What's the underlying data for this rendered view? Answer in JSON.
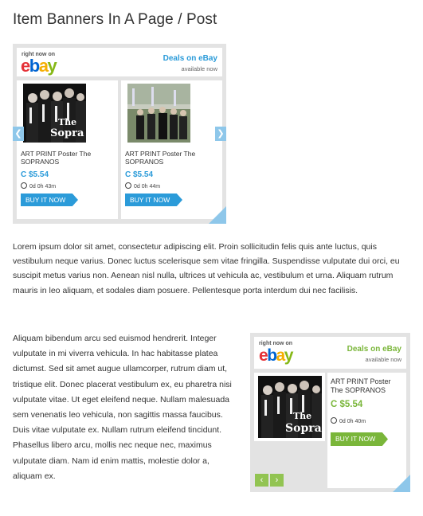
{
  "page": {
    "title": "Item Banners In A Page / Post"
  },
  "banner_wide": {
    "right_now_on": "right now on",
    "logo": [
      "e",
      "b",
      "a",
      "y"
    ],
    "deals_title": "Deals on eBay",
    "available": "available now",
    "accent_color": "#2b9bd9",
    "prev_icon": "chevron-left-icon",
    "next_icon": "chevron-right-icon",
    "prev_glyph": "❮",
    "next_glyph": "❯",
    "items": [
      {
        "title": "ART PRINT Poster The SOPRANOS",
        "price": "C $5.54",
        "time": "0d 0h 43m",
        "buy": "BUY IT NOW"
      },
      {
        "title": "ART PRINT Poster The SOPRANOS",
        "price": "C $5.54",
        "time": "0d 0h 44m",
        "buy": "BUY IT NOW"
      }
    ]
  },
  "paragraph1": "Lorem ipsum dolor sit amet, consectetur adipiscing elit. Proin sollicitudin felis quis ante luctus, quis vestibulum neque varius. Donec luctus scelerisque sem vitae fringilla. Suspendisse vulputate dui orci, eu suscipit metus varius non. Aenean nisl nulla, ultrices ut vehicula ac, vestibulum et urna. Aliquam rutrum mauris in leo aliquam, et sodales diam posuere. Pellentesque porta interdum dui nec facilisis.",
  "paragraph2": "Aliquam bibendum arcu sed euismod hendrerit. Integer vulputate in mi viverra vehicula. In hac habitasse platea dictumst. Sed sit amet augue ullamcorper, rutrum diam ut, tristique elit. Donec placerat vestibulum ex, eu pharetra nisi vulputate vitae. Ut eget eleifend neque. Nullam malesuada sem venenatis leo vehicula, non sagittis massa faucibus. Duis vitae vulputate ex. Nullam rutrum eleifend tincidunt. Phasellus libero arcu, mollis nec neque nec, maximus vulputate diam. Nam id enim mattis, molestie dolor a, aliquam ex.",
  "banner_compact": {
    "right_now_on": "right now on",
    "logo": [
      "e",
      "b",
      "a",
      "y"
    ],
    "deals_title": "Deals on eBay",
    "available": "available now",
    "accent_color": "#7ab63a",
    "prev_glyph": "‹",
    "next_glyph": "›",
    "item": {
      "title": "ART PRINT Poster The SOPRANOS",
      "price": "C $5.54",
      "time": "0d 0h 40m",
      "buy": "BUY IT NOW"
    }
  }
}
